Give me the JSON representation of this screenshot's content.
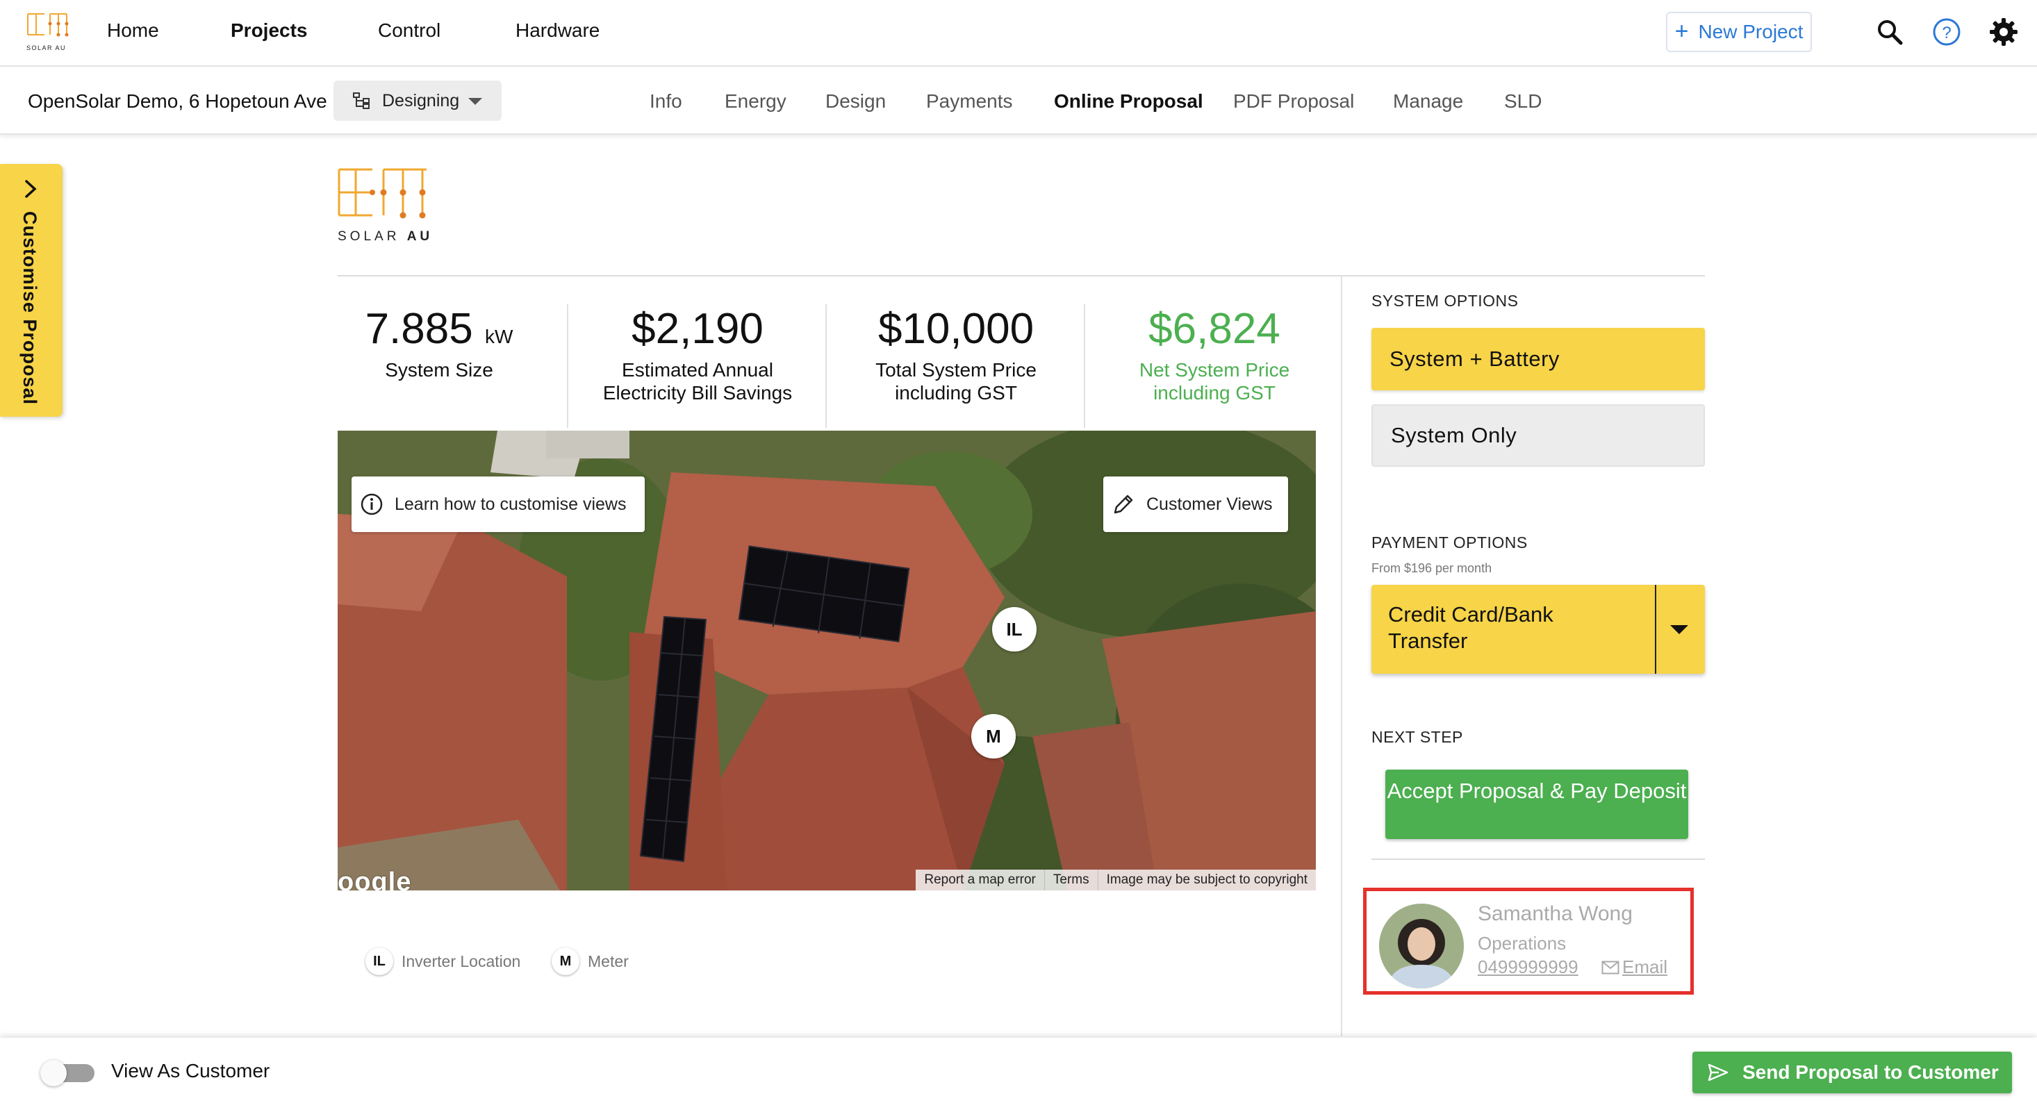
{
  "brand": {
    "logo_small_text": "SOLAR AU",
    "logo_text_light": "SOLAR ",
    "logo_text_bold": "AU",
    "accent": "#f7d448"
  },
  "nav": {
    "items": [
      {
        "label": "Home",
        "active": false
      },
      {
        "label": "Projects",
        "active": true
      },
      {
        "label": "Control",
        "active": false
      },
      {
        "label": "Hardware",
        "active": false
      }
    ],
    "new_project_plus": "+",
    "new_project_label": "New Project",
    "icons": [
      "search-icon",
      "help-icon",
      "settings-icon"
    ]
  },
  "project": {
    "title": "OpenSolar Demo, 6 Hopetoun Ave",
    "stage_label": "Designing",
    "tabs": [
      {
        "label": "Info",
        "active": false
      },
      {
        "label": "Energy",
        "active": false
      },
      {
        "label": "Design",
        "active": false
      },
      {
        "label": "Payments",
        "active": false
      },
      {
        "label": "Online Proposal",
        "active": true
      },
      {
        "label": "PDF Proposal",
        "active": false
      },
      {
        "label": "Manage",
        "active": false
      },
      {
        "label": "SLD",
        "active": false
      }
    ]
  },
  "customise_tab": {
    "label": "Customise Proposal"
  },
  "stats": [
    {
      "value": "7.885",
      "unit": "kW",
      "label_line1": "System Size",
      "label_line2": ""
    },
    {
      "value": "$2,190",
      "unit": "",
      "label_line1": "Estimated Annual",
      "label_line2": "Electricity Bill Savings"
    },
    {
      "value": "$10,000",
      "unit": "",
      "label_line1": "Total System Price",
      "label_line2": "including GST"
    },
    {
      "value": "$6,824",
      "unit": "",
      "label_line1": "Net System Price",
      "label_line2": "including GST",
      "color": "#4caf50"
    }
  ],
  "map": {
    "learn_button": "Learn how to customise views",
    "customer_views_button": "Customer Views",
    "marker_inverter": "IL",
    "marker_meter": "M",
    "google_mark": "oogle",
    "footer": [
      "Report a map error",
      "Terms",
      "Image may be subject to copyright"
    ]
  },
  "legend": [
    {
      "badge": "IL",
      "label": "Inverter Location"
    },
    {
      "badge": "M",
      "label": "Meter"
    }
  ],
  "system_options": {
    "title": "SYSTEM OPTIONS",
    "options": [
      {
        "label": "System + Battery",
        "selected": true
      },
      {
        "label": "System Only",
        "selected": false
      }
    ]
  },
  "payment_options": {
    "title": "PAYMENT OPTIONS",
    "subtitle": "From $196 per month",
    "selected": "Credit Card/Bank Transfer"
  },
  "next_step": {
    "title": "NEXT STEP",
    "button": "Accept Proposal & Pay Deposit"
  },
  "contact": {
    "name": "Samantha Wong",
    "role": "Operations",
    "phone": "0499999999",
    "email_label": "Email",
    "highlight_color": "#e5312b"
  },
  "bottom": {
    "toggle_label": "View As Customer",
    "toggle_on": false,
    "send_button": "Send Proposal to Customer",
    "send_color": "#4caf50"
  }
}
